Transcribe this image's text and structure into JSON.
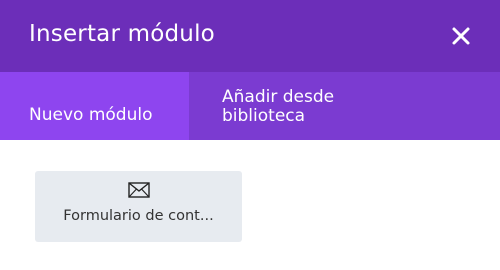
{
  "modal": {
    "title": "Insertar módulo",
    "close_icon": "close-icon"
  },
  "tabs": [
    {
      "label": "Nuevo módulo",
      "active": true
    },
    {
      "label": "Añadir desde biblioteca",
      "active": false
    }
  ],
  "modules": [
    {
      "label": "Formulario de cont...",
      "icon": "envelope-icon"
    }
  ],
  "colors": {
    "header_bg": "#6c2eb9",
    "tabbar_bg": "#7b3bd1",
    "active_tab_bg": "#8e45ef",
    "module_card_bg": "#e7ebf0"
  }
}
